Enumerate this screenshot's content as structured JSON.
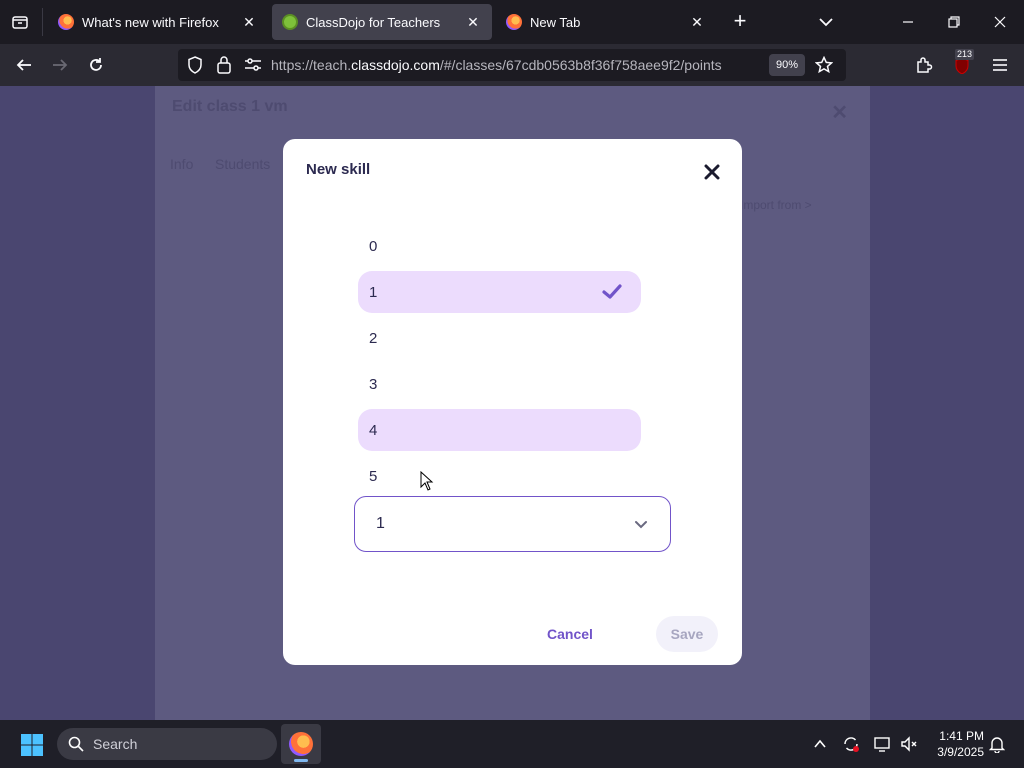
{
  "browser": {
    "tabs": [
      {
        "title": "What's new with Firefox",
        "icon": "firefox-icon",
        "active": false
      },
      {
        "title": "ClassDojo for Teachers",
        "icon": "classdojo-icon",
        "active": true
      },
      {
        "title": "New Tab",
        "icon": "firefox-icon",
        "active": false
      }
    ],
    "url_prefix": "https://teach.",
    "url_host": "classdojo.com",
    "url_path": "/#/classes/67cdb0563b8f36f758aee9f2/points",
    "zoom": "90%",
    "extension_badge": "213"
  },
  "background_panel": {
    "title": "Edit class 1 vm",
    "tabs": [
      "Info",
      "Students"
    ],
    "link": "Import from >"
  },
  "modal": {
    "title": "New skill",
    "options": [
      {
        "label": "0",
        "selected": false
      },
      {
        "label": "1",
        "selected": true
      },
      {
        "label": "2",
        "selected": false
      },
      {
        "label": "3",
        "selected": false
      },
      {
        "label": "4",
        "selected": false,
        "hovered": true
      },
      {
        "label": "5",
        "selected": false
      }
    ],
    "select_value": "1",
    "cancel_label": "Cancel",
    "save_label": "Save"
  },
  "taskbar": {
    "search_placeholder": "Search",
    "time": "1:41 PM",
    "date": "3/9/2025"
  },
  "colors": {
    "accent": "#7154c9",
    "option_highlight": "#ecdcfd",
    "backdrop": "#4a4670"
  }
}
